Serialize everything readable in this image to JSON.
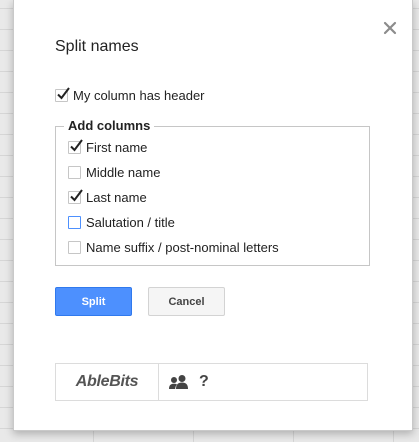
{
  "dialog": {
    "title": "Split names",
    "header_option": {
      "label": "My column has header",
      "checked": true
    },
    "add_columns": {
      "legend": "Add columns",
      "options": [
        {
          "label": "First name",
          "checked": true
        },
        {
          "label": "Middle name",
          "checked": false
        },
        {
          "label": "Last name",
          "checked": true
        },
        {
          "label": "Salutation / title",
          "checked": false,
          "focused": true
        },
        {
          "label": "Name suffix / post-nominal letters",
          "checked": false
        }
      ]
    },
    "buttons": {
      "split": "Split",
      "cancel": "Cancel"
    },
    "footer": {
      "brand": "AbleBits",
      "help": "?"
    }
  },
  "icons": {
    "close": "close-icon",
    "check": "checkmark-icon",
    "users": "users-icon"
  },
  "colors": {
    "primary": "#4d90fe",
    "focus_border": "#4d90fe",
    "text": "#222222"
  }
}
